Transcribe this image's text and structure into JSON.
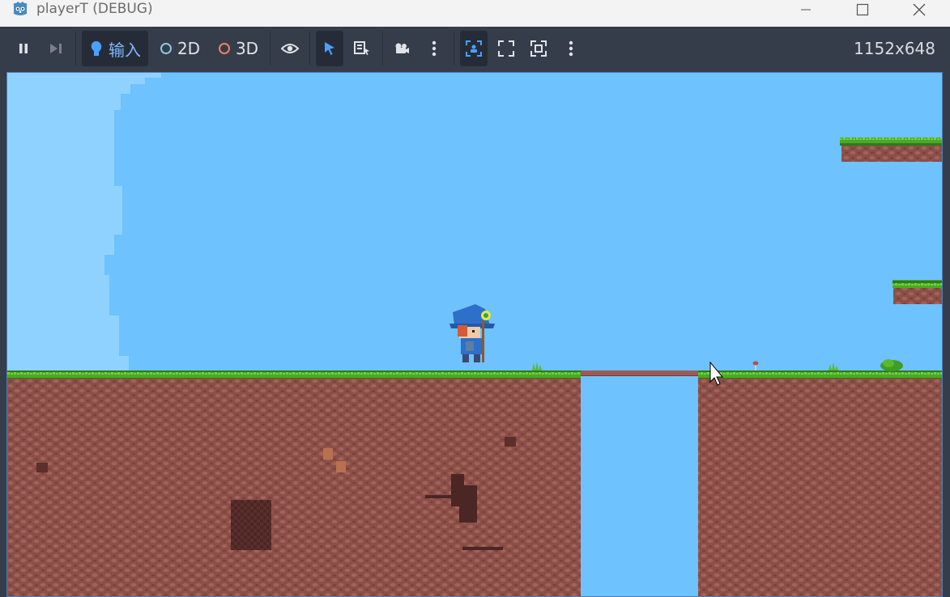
{
  "window": {
    "title": "playerT (DEBUG)",
    "app_icon": "godot-icon",
    "controls": [
      "minimize-icon",
      "maximize-icon",
      "close-icon"
    ]
  },
  "toolbar": {
    "pause_icon": "pause-icon",
    "step_icon": "step-forward-icon",
    "input_label": "输入",
    "mode_2d_label": "2D",
    "mode_3d_label": "3D",
    "visibility_icon": "eye-icon",
    "select_icon": "pointer-icon",
    "list_select_icon": "list-select-icon",
    "camera_icon": "camera-icon",
    "more_icon": "kebab-menu-icon",
    "camera_override_icon": "camera-override-icon",
    "fullscreen_icon": "fullscreen-icon",
    "embed_fit_icon": "fit-embed-icon",
    "more2_icon": "kebab-menu-icon",
    "resolution": "1152x648"
  },
  "colors": {
    "titlebar_bg": "#f3f3f3",
    "toolbar_bg": "#363d4a",
    "active_btn_bg": "#262c37",
    "accent_blue": "#4aa0ff",
    "sky": "#6ec2fd",
    "grass": "#5ab82c",
    "dirt": "#8a4f47",
    "bridge": "#9c5a55"
  },
  "game": {
    "player": "wizard-character",
    "cursor": "mouse-cursor-icon"
  }
}
